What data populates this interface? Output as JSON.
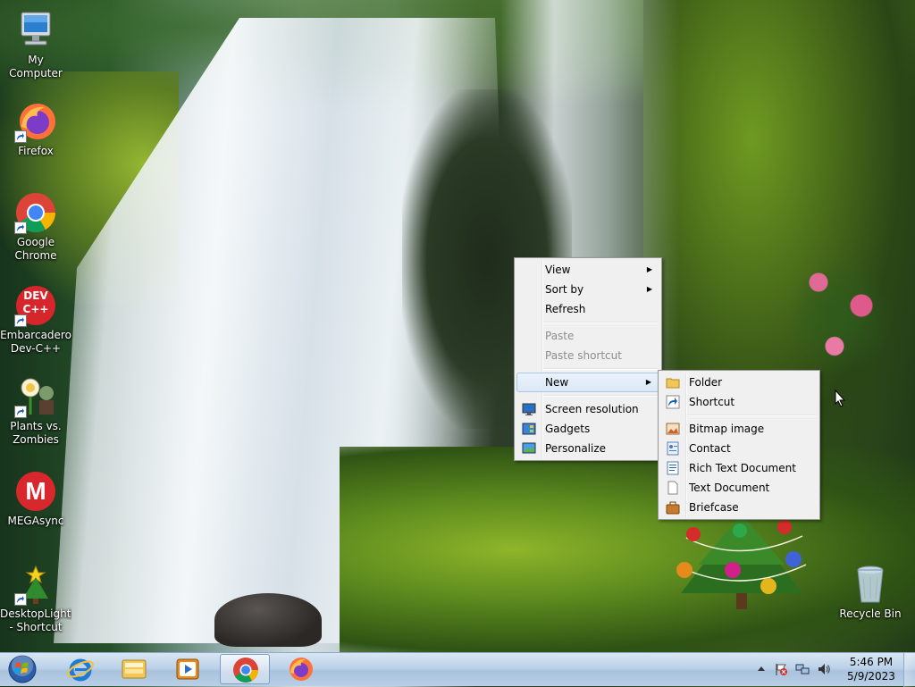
{
  "desktop": {
    "icons": [
      {
        "label": "My Computer",
        "icon": "computer-icon",
        "shortcut": false
      },
      {
        "label": "Firefox",
        "icon": "firefox-icon",
        "shortcut": true
      },
      {
        "label": "Google Chrome",
        "icon": "chrome-icon",
        "shortcut": true
      },
      {
        "label": "Embarcadero Dev-C++",
        "icon": "devcpp-icon",
        "shortcut": true,
        "icon_text": "DEV C++"
      },
      {
        "label": "Plants vs. Zombies",
        "icon": "plants-vs-zombies-icon",
        "shortcut": true
      },
      {
        "label": "MEGAsync",
        "icon": "megasync-icon",
        "shortcut": true,
        "icon_text": "M"
      },
      {
        "label": "DesktopLightingTree - Shortcut",
        "icon": "lighting-tree-icon",
        "shortcut": true
      },
      {
        "label": "Recycle Bin",
        "icon": "recycle-bin-icon",
        "shortcut": false
      }
    ]
  },
  "context_menu": {
    "items": [
      {
        "label": "View",
        "submenu": true
      },
      {
        "label": "Sort by",
        "submenu": true
      },
      {
        "label": "Refresh"
      },
      {
        "label": "Paste",
        "disabled": true
      },
      {
        "label": "Paste shortcut",
        "disabled": true
      },
      {
        "label": "New",
        "submenu": true,
        "highlighted": true
      },
      {
        "label": "Screen resolution",
        "icon": "screen-resolution-icon"
      },
      {
        "label": "Gadgets",
        "icon": "gadgets-icon"
      },
      {
        "label": "Personalize",
        "icon": "personalize-icon"
      }
    ]
  },
  "new_submenu": {
    "items": [
      {
        "label": "Folder",
        "icon": "folder-icon"
      },
      {
        "label": "Shortcut",
        "icon": "shortcut-icon"
      },
      {
        "label": "Bitmap image",
        "icon": "bitmap-image-icon"
      },
      {
        "label": "Contact",
        "icon": "contact-icon"
      },
      {
        "label": "Rich Text Document",
        "icon": "rich-text-document-icon"
      },
      {
        "label": "Text Document",
        "icon": "text-document-icon"
      },
      {
        "label": "Briefcase",
        "icon": "briefcase-icon"
      }
    ]
  },
  "taskbar": {
    "start": "start-orb-icon",
    "pinned": [
      {
        "icon": "internet-explorer-icon",
        "active": false
      },
      {
        "icon": "file-explorer-icon",
        "active": false
      },
      {
        "icon": "media-player-icon",
        "active": false
      },
      {
        "icon": "chrome-icon",
        "active": true
      },
      {
        "icon": "firefox-icon",
        "active": false
      }
    ],
    "tray": {
      "icons": [
        "show-hidden-icons-chevron",
        "action-center-flag-icon",
        "network-icon",
        "volume-icon"
      ],
      "time": "5:46 PM",
      "date": "5/9/2023"
    }
  },
  "colors": {
    "menu_bg": "#f0f0f0",
    "menu_highlight": "#dbe8f7",
    "taskbar": "#bcd2e8",
    "chrome_red": "#db4437",
    "chrome_green": "#0f9d58",
    "chrome_yellow": "#f4b400",
    "chrome_blue": "#4285f4"
  }
}
